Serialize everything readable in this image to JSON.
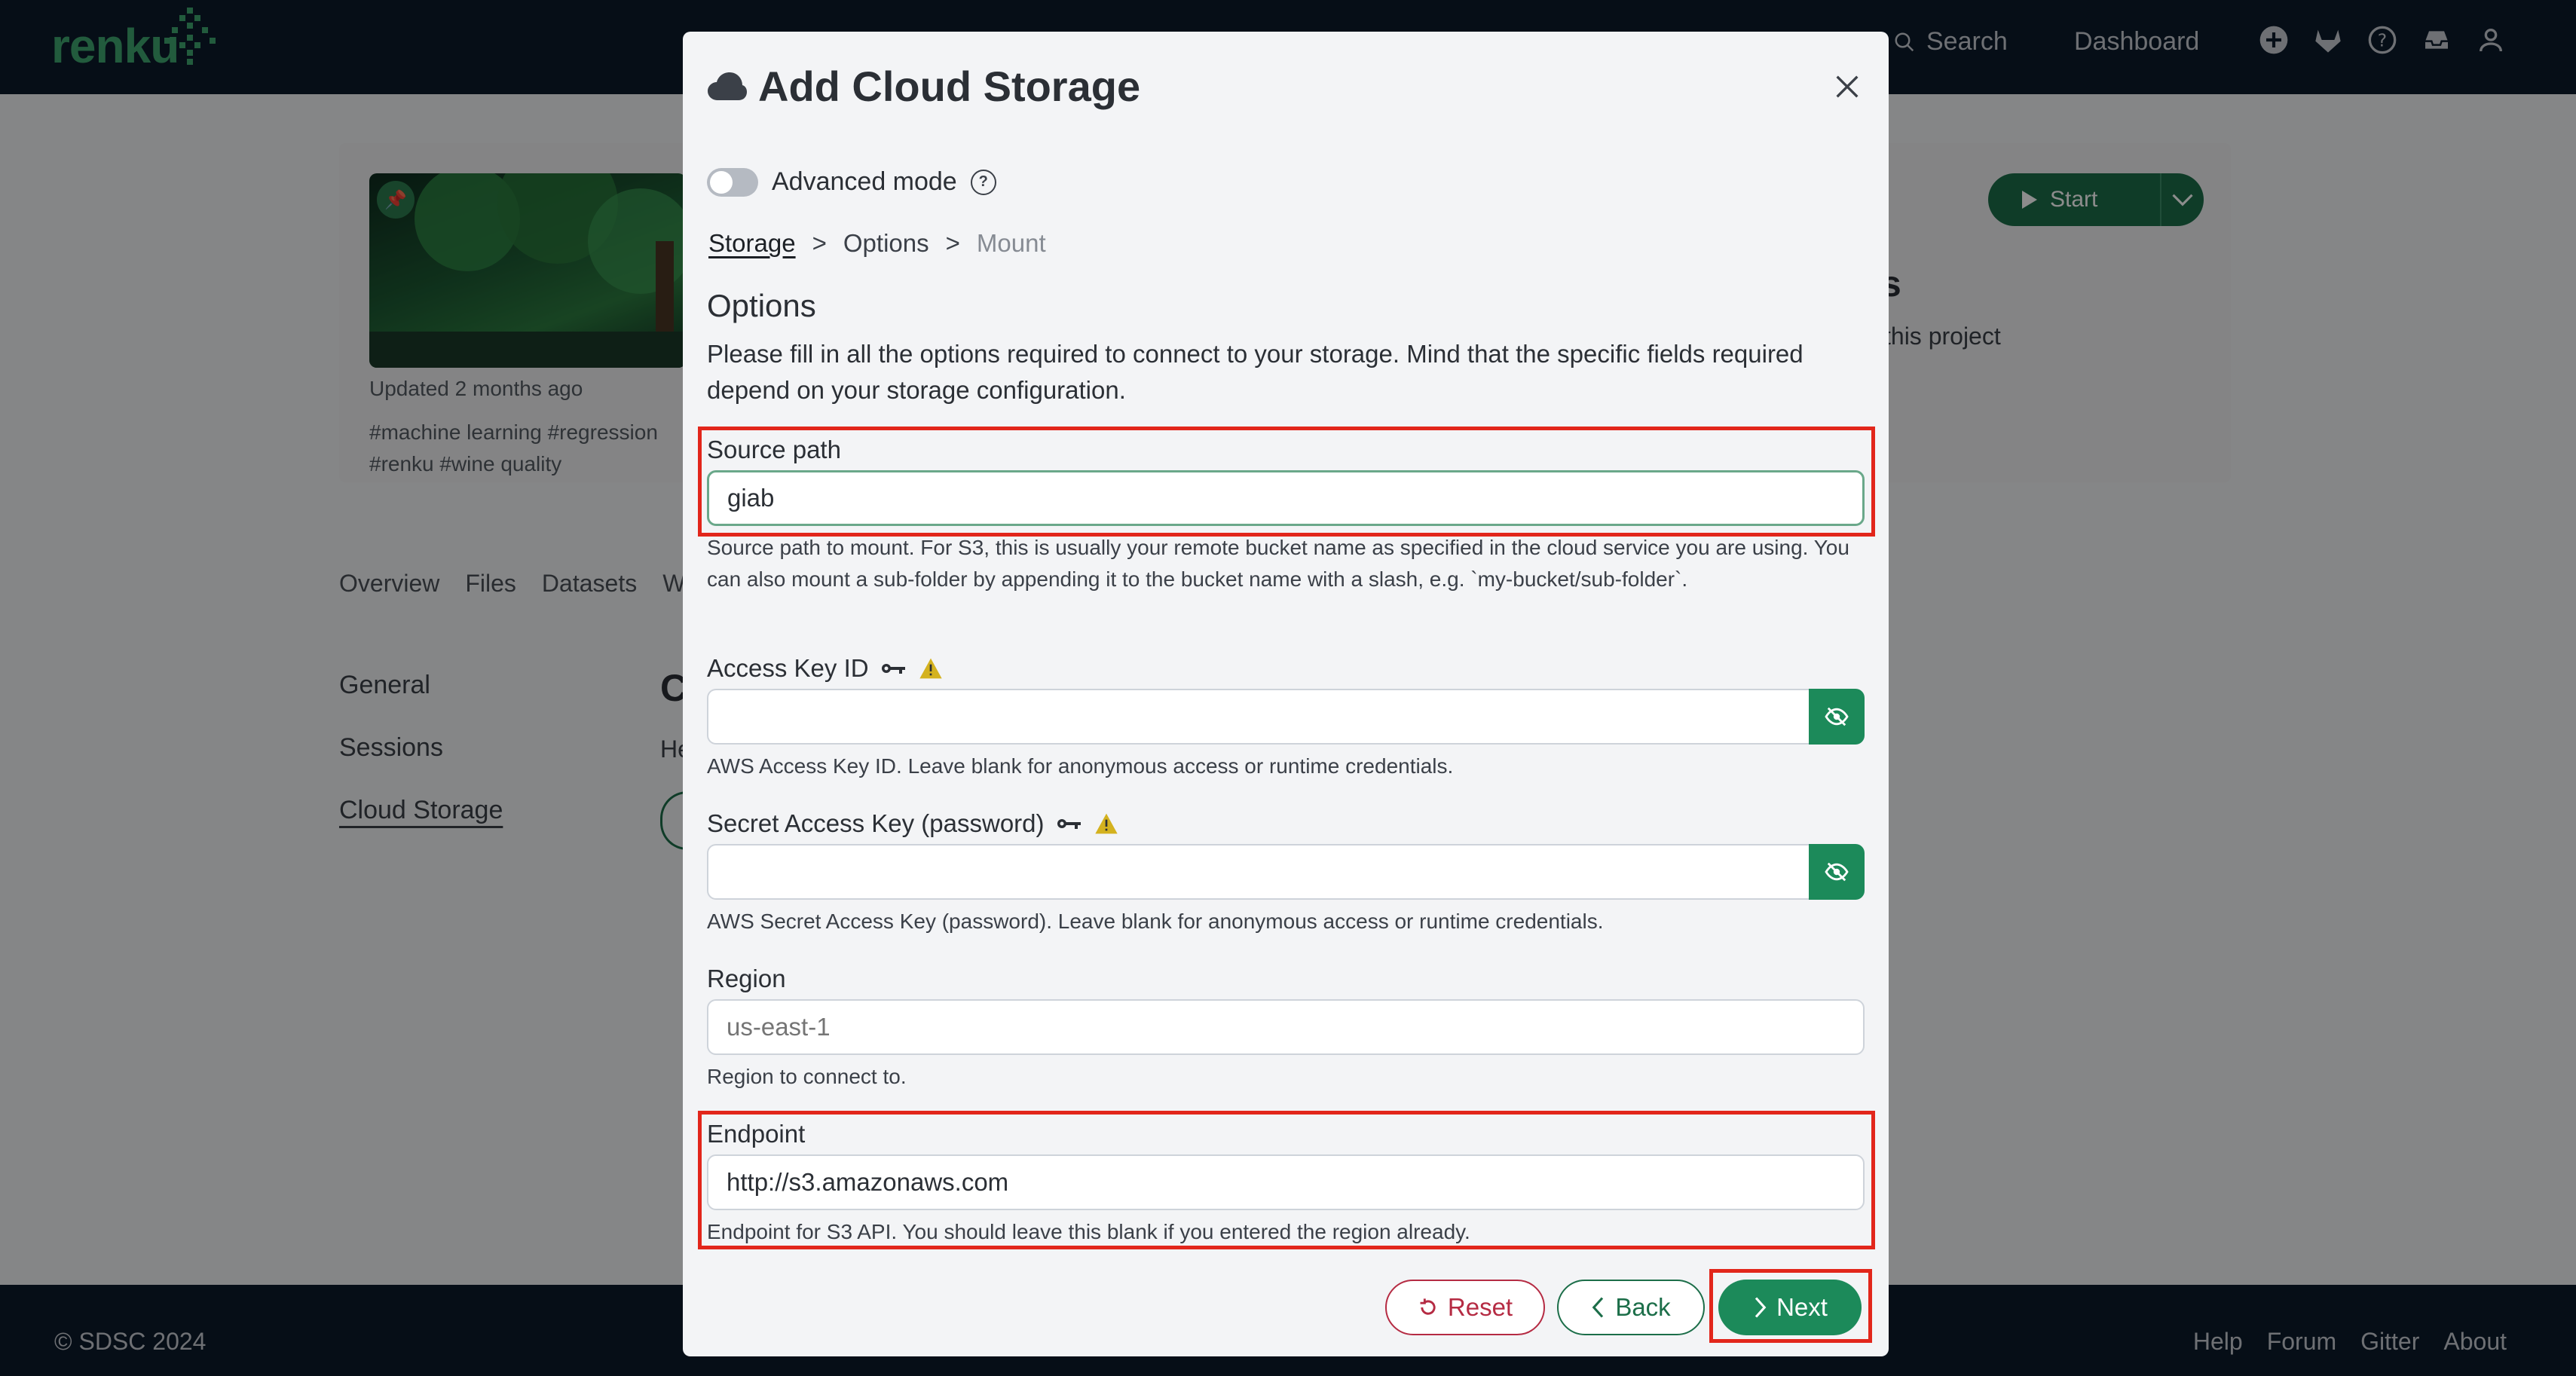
{
  "navbar": {
    "brand": "renku",
    "search_label": "Search",
    "dashboard_label": "Dashboard"
  },
  "project": {
    "updated": "Updated 2 months ago",
    "tags_line1": "#machine learning  #regression",
    "tags_line2": "#renku  #wine quality",
    "start_label": "Start",
    "heading_fragment": "ts",
    "sub_fragment": "this project"
  },
  "tabs": [
    "Overview",
    "Files",
    "Datasets",
    "W"
  ],
  "side_nav": {
    "general": "General",
    "sessions": "Sessions",
    "cloud_storage": "Cloud Storage"
  },
  "bg_content": {
    "c": "C",
    "h": "He"
  },
  "footer": {
    "copyright": "© SDSC 2024",
    "links": [
      "Help",
      "Forum",
      "Gitter",
      "About"
    ]
  },
  "modal": {
    "title": "Add Cloud Storage",
    "advanced_mode_label": "Advanced mode",
    "breadcrumb": {
      "storage": "Storage",
      "sep": ">",
      "options": "Options",
      "mount": "Mount"
    },
    "section_title": "Options",
    "intro": "Please fill in all the options required to connect to your storage. Mind that the specific fields required depend on your storage configuration.",
    "fields": {
      "source_path": {
        "label": "Source path",
        "value": "giab",
        "help": "Source path to mount. For S3, this is usually your remote bucket name as specified in the cloud service you are using. You can also mount a sub-folder by appending it to the bucket name with a slash, e.g. `my-bucket/sub-folder`."
      },
      "access_key_id": {
        "label": "Access Key ID",
        "value": "",
        "help": "AWS Access Key ID. Leave blank for anonymous access or runtime credentials."
      },
      "secret_access_key": {
        "label": "Secret Access Key (password)",
        "value": "",
        "help": "AWS Secret Access Key (password). Leave blank for anonymous access or runtime credentials."
      },
      "region": {
        "label": "Region",
        "placeholder": "us-east-1",
        "help": "Region to connect to."
      },
      "endpoint": {
        "label": "Endpoint",
        "value": "http://s3.amazonaws.com",
        "help": "Endpoint for S3 API. You should leave this blank if you entered the region already."
      }
    },
    "buttons": {
      "reset": "Reset",
      "back": "Back",
      "next": "Next"
    }
  },
  "colors": {
    "accent": "#1c8a5a",
    "highlight": "#e2261b",
    "danger": "#b52b43",
    "warning": "#d4b21f"
  }
}
